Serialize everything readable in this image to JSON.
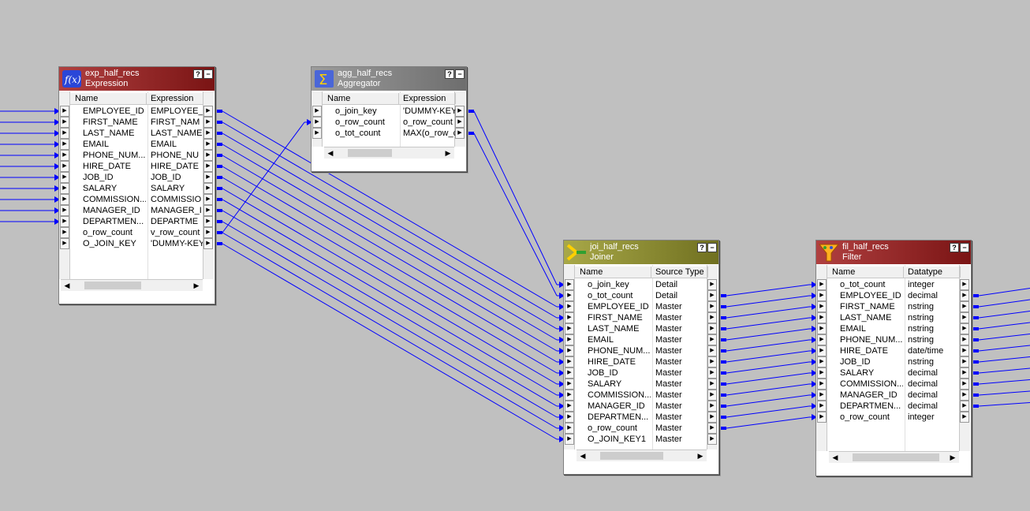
{
  "transformations": {
    "exp": {
      "name": "exp_half_recs",
      "type": "Expression",
      "columns": [
        "Name",
        "Expression"
      ],
      "rows": [
        [
          "EMPLOYEE_ID",
          "EMPLOYEE_"
        ],
        [
          "FIRST_NAME",
          "FIRST_NAM"
        ],
        [
          "LAST_NAME",
          "LAST_NAME"
        ],
        [
          "EMAIL",
          "EMAIL"
        ],
        [
          "PHONE_NUM...",
          "PHONE_NU"
        ],
        [
          "HIRE_DATE",
          "HIRE_DATE"
        ],
        [
          "JOB_ID",
          "JOB_ID"
        ],
        [
          "SALARY",
          "SALARY"
        ],
        [
          "COMMISSION...",
          "COMMISSIO"
        ],
        [
          "MANAGER_ID",
          "MANAGER_I"
        ],
        [
          "DEPARTMEN...",
          "DEPARTME"
        ],
        [
          "o_row_count",
          "v_row_count"
        ],
        [
          "O_JOIN_KEY",
          "'DUMMY-KEY"
        ]
      ]
    },
    "agg": {
      "name": "agg_half_recs",
      "type": "Aggregator",
      "columns": [
        "Name",
        "Expression"
      ],
      "rows": [
        [
          "o_join_key",
          "'DUMMY-KEY"
        ],
        [
          "o_row_count",
          "o_row_count"
        ],
        [
          "o_tot_count",
          "MAX(o_row_c"
        ]
      ]
    },
    "joi": {
      "name": "joi_half_recs",
      "type": "Joiner",
      "columns": [
        "Name",
        "Source Type"
      ],
      "rows": [
        [
          "o_join_key",
          "Detail"
        ],
        [
          "o_tot_count",
          "Detail"
        ],
        [
          "EMPLOYEE_ID",
          "Master"
        ],
        [
          "FIRST_NAME",
          "Master"
        ],
        [
          "LAST_NAME",
          "Master"
        ],
        [
          "EMAIL",
          "Master"
        ],
        [
          "PHONE_NUM...",
          "Master"
        ],
        [
          "HIRE_DATE",
          "Master"
        ],
        [
          "JOB_ID",
          "Master"
        ],
        [
          "SALARY",
          "Master"
        ],
        [
          "COMMISSION...",
          "Master"
        ],
        [
          "MANAGER_ID",
          "Master"
        ],
        [
          "DEPARTMEN...",
          "Master"
        ],
        [
          "o_row_count",
          "Master"
        ],
        [
          "O_JOIN_KEY1",
          "Master"
        ]
      ]
    },
    "fil": {
      "name": "fil_half_recs",
      "type": "Filter",
      "columns": [
        "Name",
        "Datatype"
      ],
      "rows": [
        [
          "o_tot_count",
          "integer"
        ],
        [
          "EMPLOYEE_ID",
          "decimal"
        ],
        [
          "FIRST_NAME",
          "nstring"
        ],
        [
          "LAST_NAME",
          "nstring"
        ],
        [
          "EMAIL",
          "nstring"
        ],
        [
          "PHONE_NUM...",
          "nstring"
        ],
        [
          "HIRE_DATE",
          "date/time"
        ],
        [
          "JOB_ID",
          "nstring"
        ],
        [
          "SALARY",
          "decimal"
        ],
        [
          "COMMISSION...",
          "decimal"
        ],
        [
          "MANAGER_ID",
          "decimal"
        ],
        [
          "DEPARTMEN...",
          "decimal"
        ],
        [
          "o_row_count",
          "integer"
        ]
      ]
    }
  },
  "buttons": {
    "help": "?",
    "minimize": "−"
  },
  "colors": {
    "link": "#0000ff",
    "canvas": "#c0c0c0"
  }
}
